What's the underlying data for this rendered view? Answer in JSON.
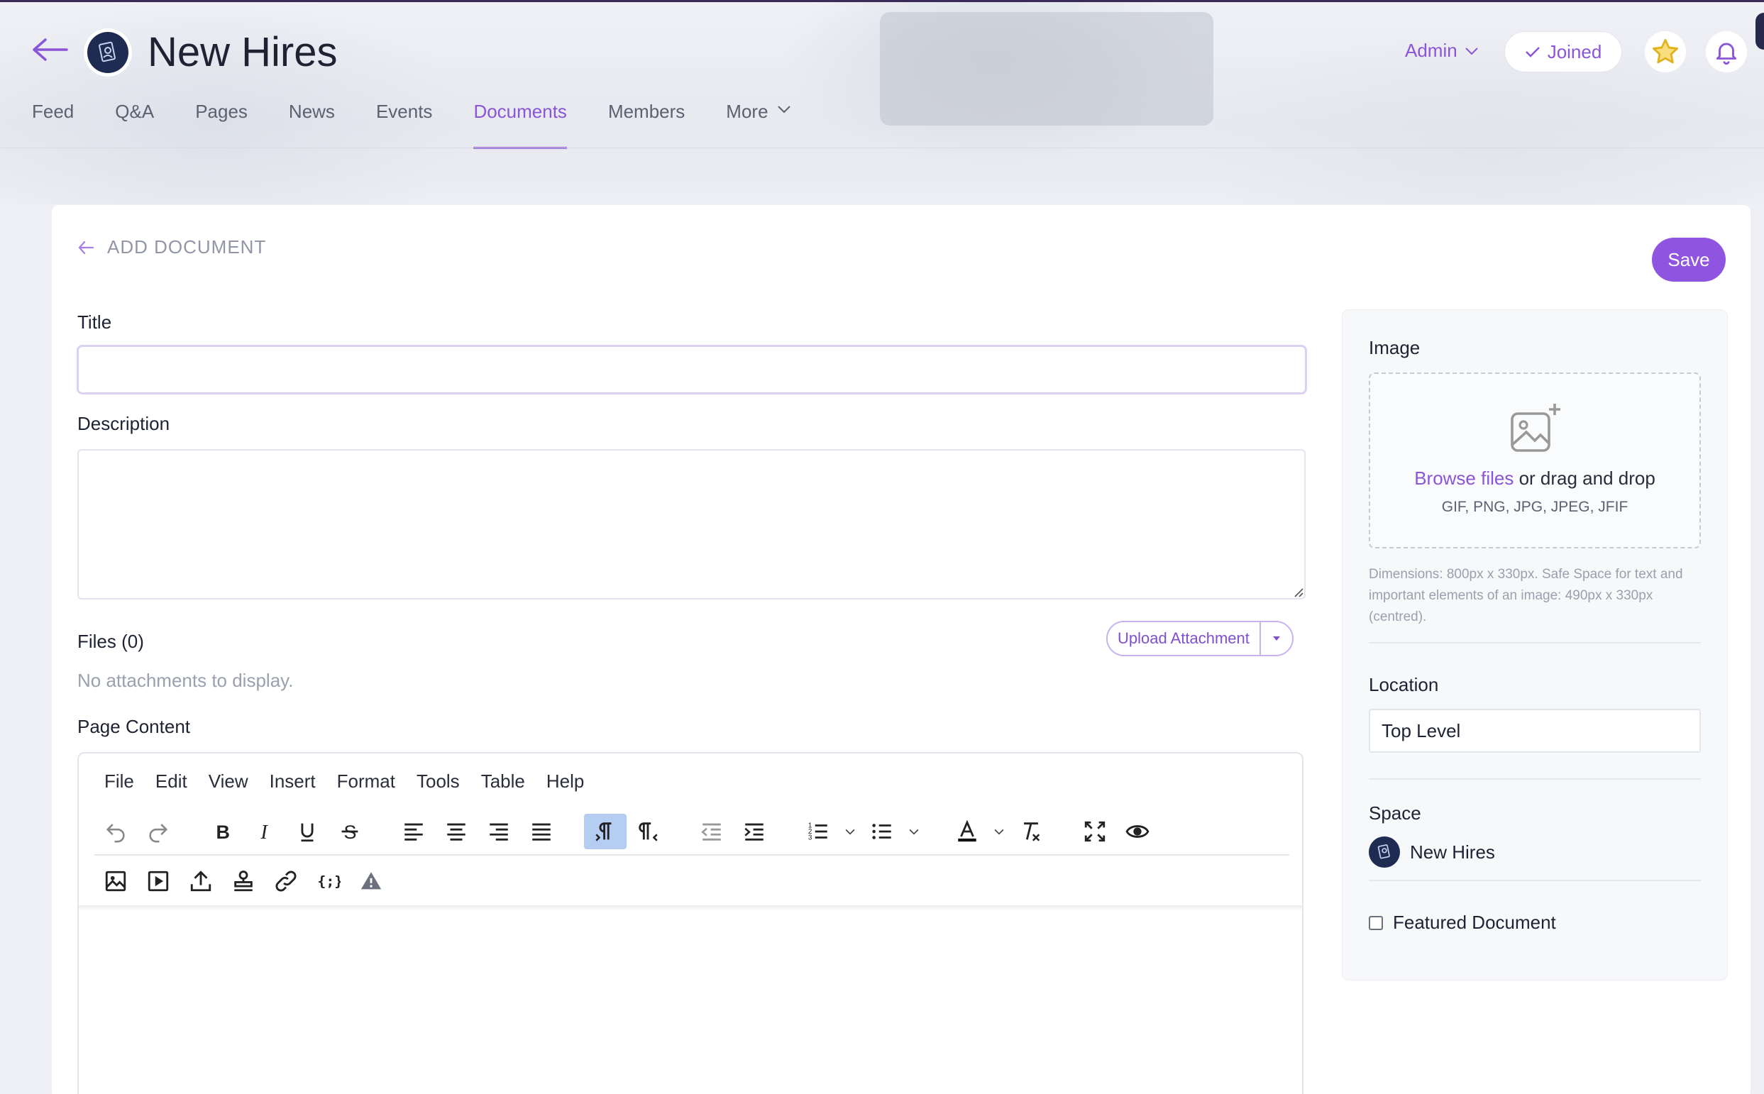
{
  "header": {
    "title": "New Hires",
    "admin_label": "Admin",
    "joined_label": "Joined"
  },
  "tabs": [
    {
      "label": "Feed"
    },
    {
      "label": "Q&A"
    },
    {
      "label": "Pages"
    },
    {
      "label": "News"
    },
    {
      "label": "Events"
    },
    {
      "label": "Documents",
      "active": true
    },
    {
      "label": "Members"
    },
    {
      "label": "More"
    }
  ],
  "form": {
    "breadcrumb": "ADD DOCUMENT",
    "save_label": "Save",
    "title_label": "Title",
    "title_value": "",
    "description_label": "Description",
    "description_value": "",
    "files_label": "Files (0)",
    "upload_label": "Upload Attachment",
    "no_attachments": "No attachments to display.",
    "page_content_label": "Page Content"
  },
  "editor": {
    "menu": [
      "File",
      "Edit",
      "View",
      "Insert",
      "Format",
      "Tools",
      "Table",
      "Help"
    ],
    "toolbar_row1": [
      "undo-icon",
      "redo-icon",
      "bold-icon",
      "italic-icon",
      "underline-icon",
      "strikethrough-icon",
      "align-left-icon",
      "align-center-icon",
      "align-right-icon",
      "align-justify-icon",
      "ltr-icon",
      "rtl-icon",
      "outdent-icon",
      "indent-icon",
      "numbered-list-icon",
      "bullet-list-icon",
      "text-color-icon",
      "clear-format-icon",
      "fullscreen-icon",
      "preview-icon"
    ],
    "toolbar_row2": [
      "image-icon",
      "media-icon",
      "upload-icon",
      "stamp-icon",
      "link-icon",
      "code-braces-icon",
      "warning-icon"
    ],
    "active_tool": "ltr-icon"
  },
  "sidebar": {
    "image_label": "Image",
    "browse_label": "Browse files",
    "drop_label": " or drag and drop",
    "file_types": "GIF, PNG, JPG, JPEG, JFIF",
    "dimensions_note": "Dimensions: 800px x 330px. Safe Space for text and important elements of an image: 490px x 330px (centred).",
    "location_label": "Location",
    "location_value": "Top Level",
    "space_label": "Space",
    "space_value": "New Hires",
    "featured_label": "Featured Document",
    "featured_checked": false
  },
  "colors": {
    "accent": "#8f55e0",
    "link": "#8a55d8",
    "active_tool_bg": "#b5cdf3",
    "star": "#f3c52e"
  }
}
